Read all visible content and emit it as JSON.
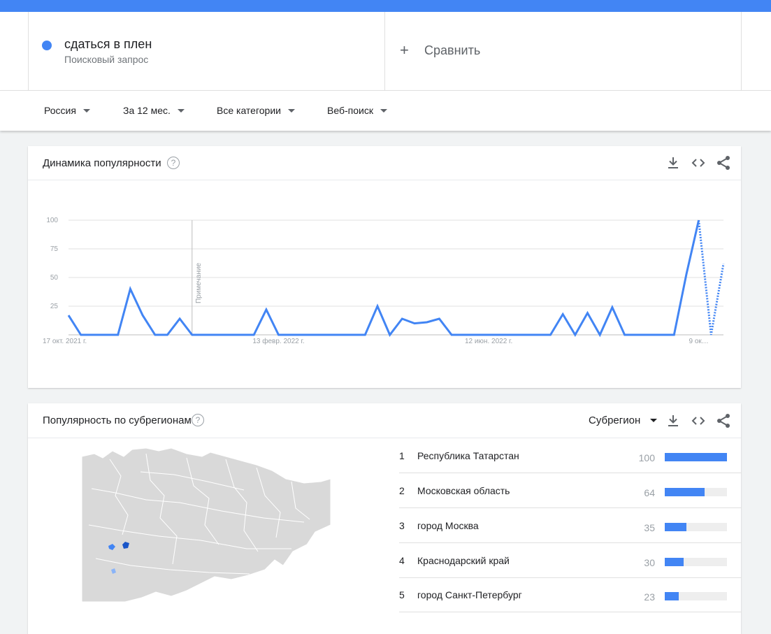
{
  "header": {
    "term_name": "сдаться в плен",
    "term_type": "Поисковый запрос",
    "compare_label": "Сравнить",
    "term_color": "#4285f4"
  },
  "filters": {
    "region": "Россия",
    "period": "За 12 мес.",
    "category": "Все категории",
    "search_type": "Веб-поиск"
  },
  "interest_card": {
    "title": "Динамика популярности",
    "help_symbol": "?",
    "annotation": "Примечание"
  },
  "chart_data": {
    "type": "line",
    "ylim": [
      0,
      100
    ],
    "y_ticks": [
      "100",
      "75",
      "50",
      "25"
    ],
    "x_tick_labels": [
      "17 окт. 2021 г.",
      "13 февр. 2022 г.",
      "12 июн. 2022 г.",
      "9 ок…"
    ],
    "note_week_index": 10,
    "partial_from_index": 51,
    "series": [
      {
        "color": "#4285f4",
        "values": [
          17,
          0,
          0,
          0,
          0,
          40,
          17,
          0,
          0,
          14,
          0,
          0,
          0,
          0,
          0,
          0,
          22,
          0,
          0,
          0,
          0,
          0,
          0,
          0,
          0,
          25,
          0,
          14,
          10,
          11,
          14,
          0,
          0,
          0,
          0,
          0,
          0,
          0,
          0,
          0,
          18,
          0,
          19,
          0,
          24,
          0,
          0,
          0,
          0,
          0,
          53,
          100,
          0,
          62
        ]
      }
    ]
  },
  "region_card": {
    "title": "Популярность по субрегионам",
    "help_symbol": "?",
    "selector": "Субрегион",
    "rows": [
      {
        "rank": "1",
        "name": "Республика Татарстан",
        "value": "100"
      },
      {
        "rank": "2",
        "name": "Московская область",
        "value": "64"
      },
      {
        "rank": "3",
        "name": "город Москва",
        "value": "35"
      },
      {
        "rank": "4",
        "name": "Краснодарский край",
        "value": "30"
      },
      {
        "rank": "5",
        "name": "город Санкт-Петербург",
        "value": "23"
      }
    ]
  },
  "icons": [
    "download-icon",
    "embed-icon",
    "share-icon",
    "help-icon",
    "plus-icon",
    "caret-down-icon"
  ]
}
